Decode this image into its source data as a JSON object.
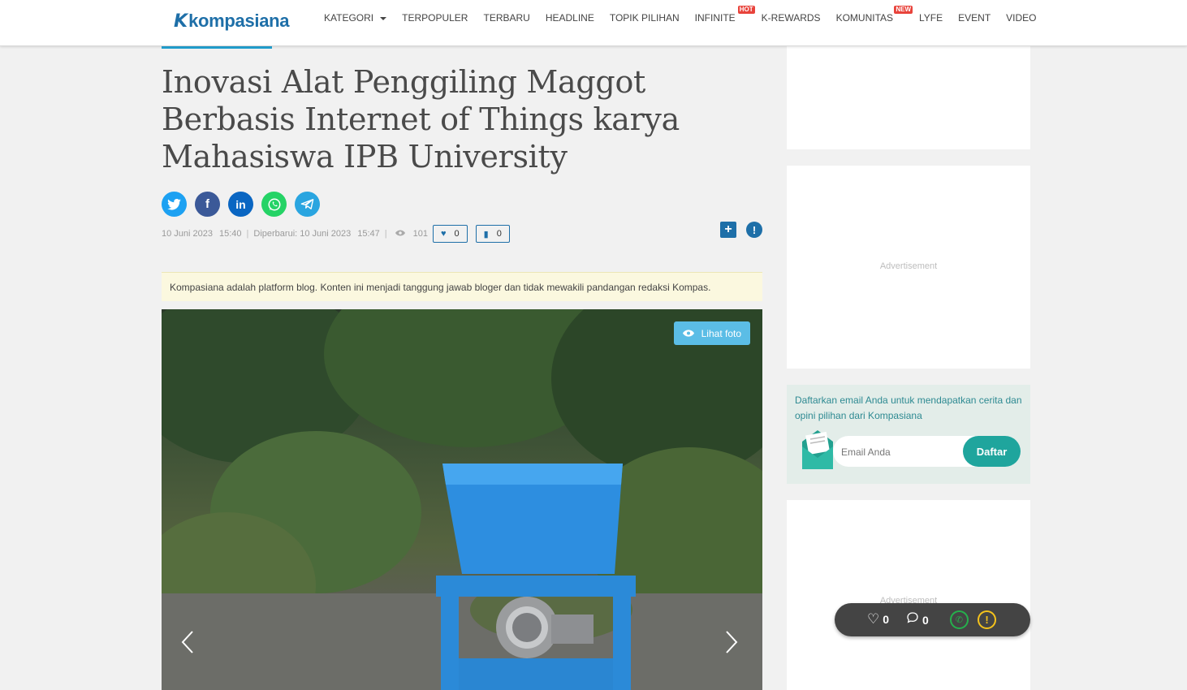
{
  "header": {
    "logo_mark": "K",
    "logo_text": "kompasiana",
    "nav": [
      {
        "label": "KATEGORI"
      },
      {
        "label": "TERPOPULER"
      },
      {
        "label": "TERBARU"
      },
      {
        "label": "HEADLINE"
      },
      {
        "label": "TOPIK PILIHAN"
      },
      {
        "label": "INFINITE",
        "badge": "HOT"
      },
      {
        "label": "K-REWARDS"
      },
      {
        "label": "KOMUNITAS",
        "badge": "NEW"
      },
      {
        "label": "LYFE"
      },
      {
        "label": "EVENT"
      },
      {
        "label": "VIDEO"
      }
    ]
  },
  "article": {
    "title": "Inovasi Alat Penggiling Maggot Berbasis Internet of Things karya Mahasiswa IPB University",
    "share_icons": [
      "twitter-icon",
      "facebook-icon",
      "linkedin-icon",
      "whatsapp-icon",
      "telegram-icon"
    ],
    "published_date": "10 Juni 2023",
    "published_time": "15:40",
    "updated_label": "Diperbarui: 10 Juni 2023",
    "updated_time": "15:47",
    "views": "101",
    "likes": "0",
    "comments": "0",
    "disclaimer": "Kompasiana adalah platform blog. Konten ini menjadi tanggung jawab bloger dan tidak mewakili pandangan redaksi Kompas.",
    "view_photo_label": "Lihat foto"
  },
  "sidebar": {
    "ad_label": "Advertisement",
    "newsletter_text": "Daftarkan email Anda untuk mendapatkan cerita dan opini pilihan dari Kompasiana",
    "email_placeholder": "Email Anda",
    "subscribe_label": "Daftar"
  },
  "floating_bar": {
    "likes": "0",
    "comments": "0"
  },
  "colors": {
    "brand": "#1e6fa8",
    "accent": "#22a3d4",
    "subscribe": "#1fa59d",
    "twitter": "#1da1f2",
    "facebook": "#3b5998",
    "linkedin": "#0a66c2",
    "whatsapp": "#25d366",
    "telegram": "#2aa5e0"
  }
}
